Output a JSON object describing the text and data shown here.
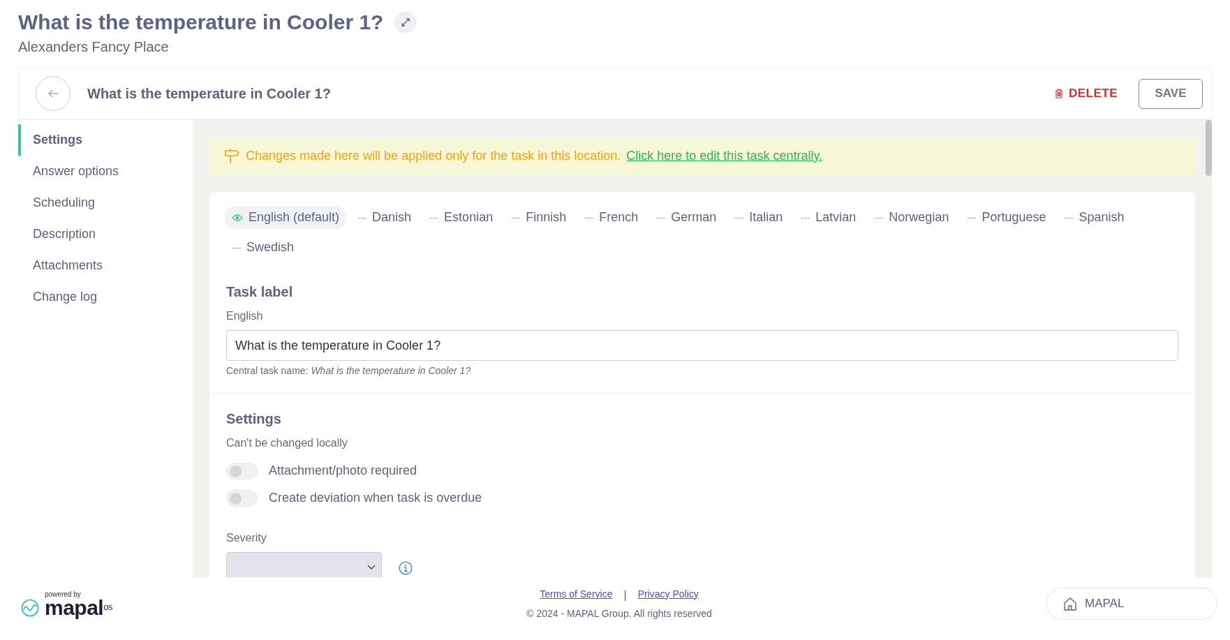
{
  "page": {
    "title": "What is the temperature in Cooler 1?",
    "subtitle": "Alexanders Fancy Place"
  },
  "header": {
    "title": "What is the temperature in Cooler 1?",
    "delete": "DELETE",
    "save": "SAVE"
  },
  "sidebar": {
    "items": [
      {
        "label": "Settings",
        "selected": true
      },
      {
        "label": "Answer options",
        "selected": false
      },
      {
        "label": "Scheduling",
        "selected": false
      },
      {
        "label": "Description",
        "selected": false
      },
      {
        "label": "Attachments",
        "selected": false
      },
      {
        "label": "Change log",
        "selected": false
      }
    ]
  },
  "notice": {
    "text": "Changes made here will be applied only for the task in this location.",
    "link": "Click here to edit this task centrally."
  },
  "languages": [
    {
      "label": "English (default)",
      "selected": true
    },
    {
      "label": "Danish",
      "selected": false,
      "mark": "---"
    },
    {
      "label": "Estonian",
      "selected": false,
      "mark": "---"
    },
    {
      "label": "Finnish",
      "selected": false,
      "mark": "---"
    },
    {
      "label": "French",
      "selected": false,
      "mark": "---"
    },
    {
      "label": "German",
      "selected": false,
      "mark": "---"
    },
    {
      "label": "Italian",
      "selected": false,
      "mark": "---"
    },
    {
      "label": "Latvian",
      "selected": false,
      "mark": "---"
    },
    {
      "label": "Norwegian",
      "selected": false,
      "mark": "---"
    },
    {
      "label": "Portuguese",
      "selected": false,
      "mark": "---"
    },
    {
      "label": "Spanish",
      "selected": false,
      "mark": "---"
    },
    {
      "label": "Swedish",
      "selected": false,
      "mark": "---"
    }
  ],
  "task_label": {
    "heading": "Task label",
    "field_label": "English",
    "value": "What is the temperature in Cooler 1?",
    "hint": "Central task name: *What is the temperature in Cooler 1?*"
  },
  "settings": {
    "heading": "Settings",
    "note": "Can't be changed locally",
    "toggles": [
      {
        "label": "Attachment/photo required",
        "on": false
      },
      {
        "label": "Create deviation when task is overdue",
        "on": false
      }
    ],
    "severity_label": "Severity"
  },
  "footer": {
    "powered_by": "powered by",
    "logo": "mapal",
    "logo_suffix": "os",
    "links": [
      "Terms of Service",
      "Privacy Policy"
    ],
    "separator": "|",
    "copyright": "© 2024 - MAPAL Group. All rights reserved",
    "app_button": "MAPAL"
  }
}
